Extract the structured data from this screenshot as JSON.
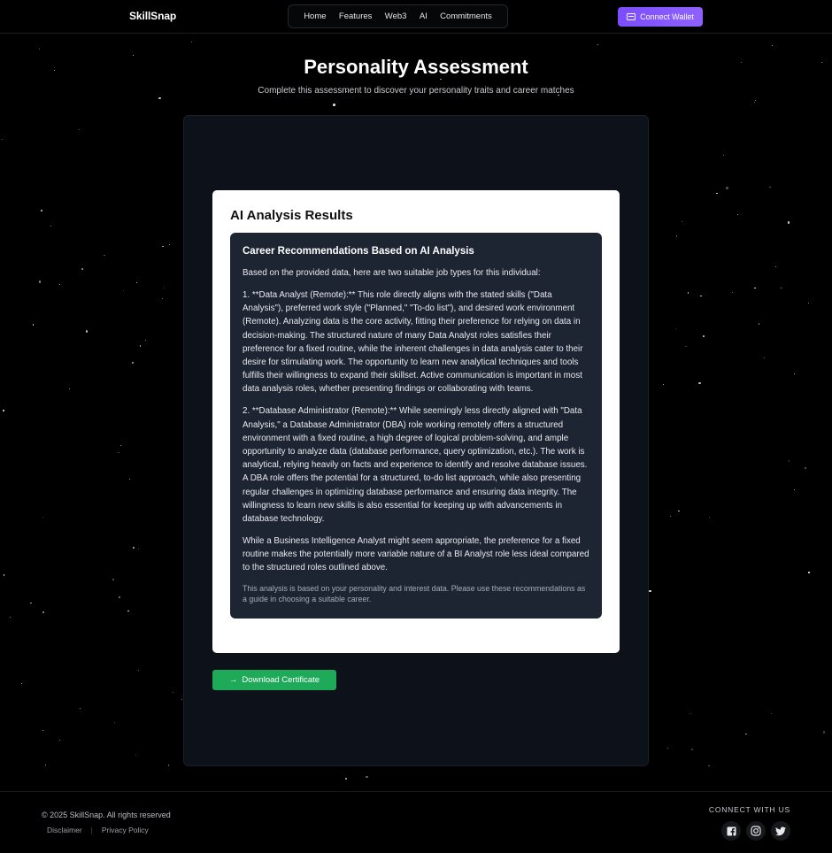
{
  "nav": {
    "brand": "SkillSnap",
    "links": [
      "Home",
      "Features",
      "Web3",
      "AI",
      "Commitments"
    ],
    "wallet_button": "Connect Wallet"
  },
  "header": {
    "title": "Personality Assessment",
    "subtitle": "Complete this assessment to discover your personality traits and career matches"
  },
  "results": {
    "card_title": "AI Analysis Results",
    "heading": "Career Recommendations Based on AI Analysis",
    "paragraphs": [
      "Based on the provided data, here are two suitable job types for this individual:",
      "1. **Data Analyst (Remote):** This role directly aligns with the stated skills (\"Data Analysis\"), preferred work style (\"Planned,\" \"To-do list\"), and desired work environment (Remote).  Analyzing data is the core activity, fitting their preference for relying on data in decision-making. The structured nature of many Data Analyst roles satisfies their preference for a fixed routine, while the inherent challenges in data analysis cater to their desire for stimulating work.  The opportunity to learn new analytical techniques and tools fulfills their willingness to expand their skillset.  Active communication is important in most data analysis roles, whether presenting findings or collaborating with teams.",
      "2. **Database Administrator (Remote):** While seemingly less directly aligned with \"Data Analysis,\" a Database Administrator (DBA) role working remotely offers a structured environment with a fixed routine,  a high degree of logical problem-solving, and ample opportunity to analyze data (database performance, query optimization, etc.).  The work is analytical, relying heavily on facts and experience to identify and resolve database issues.  A DBA role offers the potential for a structured, to-do list approach, while also presenting regular challenges in optimizing database performance and ensuring data integrity.  The willingness to learn new skills is also essential for keeping up with advancements in database technology.",
      "While a Business Intelligence Analyst might seem appropriate,  the preference for a fixed routine makes the potentially more variable nature of a BI Analyst role less ideal compared to the structured roles outlined above."
    ],
    "note": "This analysis is based on your personality and interest data. Please use these recommendations as a guide in choosing a suitable career."
  },
  "actions": {
    "download_button": "Download Certificate",
    "download_icon": "arrow-right-icon"
  },
  "footer": {
    "copyright": "© 2025 SkillSnap. All rights reserved",
    "links": [
      "Disclaimer",
      "Privacy Policy"
    ],
    "connect_label": "CONNECT WITH US",
    "socials": [
      "facebook-icon",
      "instagram-icon",
      "twitter-icon"
    ]
  },
  "colors": {
    "background": "#000000",
    "panel": "#0d1119",
    "analysis_box": "#1d2533",
    "wallet_button": "#8455ff",
    "download_button": "#1faa5a"
  }
}
